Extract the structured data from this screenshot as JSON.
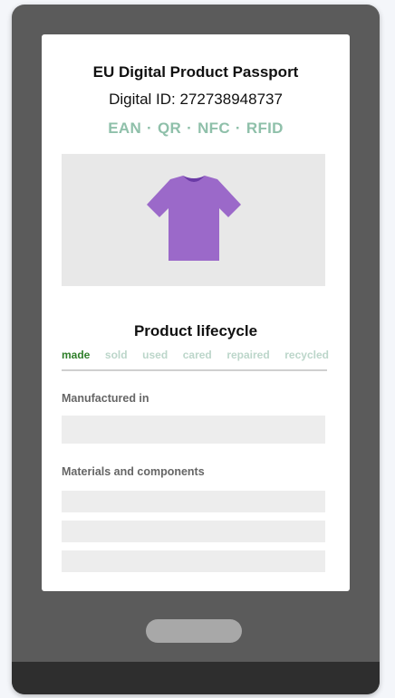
{
  "passport": {
    "title": "EU Digital Product Passport",
    "digital_id": "Digital ID: 272738948737",
    "tech_tags": [
      "EAN",
      "QR",
      "NFC",
      "RFID"
    ],
    "separator": "·"
  },
  "product_image": {
    "icon": "tshirt-icon",
    "color": "#9b69c9",
    "collar_color": "#6a3aa6"
  },
  "lifecycle": {
    "title": "Product lifecycle",
    "stages": [
      "made",
      "sold",
      "used",
      "cared",
      "repaired",
      "recycled"
    ],
    "active_stage": "made",
    "colors": {
      "active": "#2f7f2a",
      "inactive": "#bcd6ca"
    }
  },
  "sections": {
    "manufactured_label": "Manufactured in",
    "materials_label": "Materials and components"
  },
  "theme": {
    "phone_body": "#5b5b5b",
    "phone_bottom": "#2e2e2e",
    "home_button": "#a8a8a8",
    "tag_color": "#8fc0aa"
  }
}
